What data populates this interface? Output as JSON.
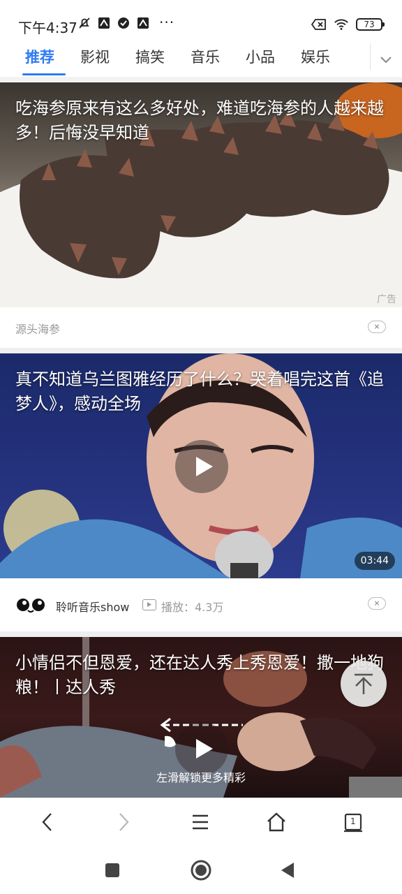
{
  "status_bar": {
    "time": "下午4:37",
    "more": "···",
    "battery": "73"
  },
  "tabs": [
    {
      "label": "推荐",
      "active": true
    },
    {
      "label": "影视",
      "active": false
    },
    {
      "label": "搞笑",
      "active": false
    },
    {
      "label": "音乐",
      "active": false
    },
    {
      "label": "小品",
      "active": false
    },
    {
      "label": "娱乐",
      "active": false
    }
  ],
  "feed": [
    {
      "title": "吃海参原来有这么多好处，难道吃海参的人越来越多！后悔没早知道",
      "ad_label": "广告",
      "source": "源头海参",
      "close": "×"
    },
    {
      "title": "真不知道乌兰图雅经历了什么？哭着唱完这首《追梦人》，感动全场",
      "duration": "03:44",
      "author": "聆听音乐show",
      "plays": "播放：4.3万",
      "close": "×"
    },
    {
      "title": "小情侣不但恩爱，还在达人秀上秀恩爱！撒一地狗粮！丨达人秀",
      "swipe_hint": "左滑解锁更多精彩"
    }
  ],
  "toolbar": {
    "tab_count": "1"
  },
  "colors": {
    "accent": "#2f7bf5"
  }
}
